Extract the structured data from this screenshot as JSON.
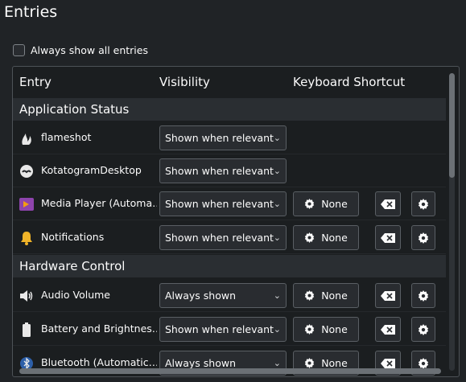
{
  "page": {
    "title": "Entries"
  },
  "always_show": {
    "label": "Always show all entries",
    "checked": false
  },
  "columns": {
    "entry": "Entry",
    "visibility": "Visibility",
    "shortcut": "Keyboard Shortcut"
  },
  "sections": [
    {
      "title": "Application Status",
      "entries": [
        {
          "name": "flameshot",
          "icon": "flameshot-icon",
          "visibility": "Shown when relevant",
          "has_shortcut": false
        },
        {
          "name": "KotatogramDesktop",
          "icon": "kotatogram-icon",
          "visibility": "Shown when relevant",
          "has_shortcut": false
        },
        {
          "name": "Media Player (Automa…",
          "icon": "media-player-icon",
          "visibility": "Shown when relevant",
          "has_shortcut": true,
          "shortcut": "None"
        },
        {
          "name": "Notifications",
          "icon": "bell-icon",
          "visibility": "Shown when relevant",
          "has_shortcut": true,
          "shortcut": "None"
        }
      ]
    },
    {
      "title": "Hardware Control",
      "entries": [
        {
          "name": "Audio Volume",
          "icon": "speaker-icon",
          "visibility": "Always shown",
          "has_shortcut": true,
          "shortcut": "None"
        },
        {
          "name": "Battery and Brightnes…",
          "icon": "battery-icon",
          "visibility": "Shown when relevant",
          "has_shortcut": true,
          "shortcut": "None"
        },
        {
          "name": "Bluetooth (Automatic…",
          "icon": "bluetooth-icon",
          "visibility": "Always shown",
          "has_shortcut": true,
          "shortcut": "None"
        }
      ]
    }
  ],
  "colors": {
    "background": "#202326",
    "frame": "#1b1e20",
    "section": "#2a2e32",
    "control": "#292c30",
    "bell": "#f0b429"
  }
}
